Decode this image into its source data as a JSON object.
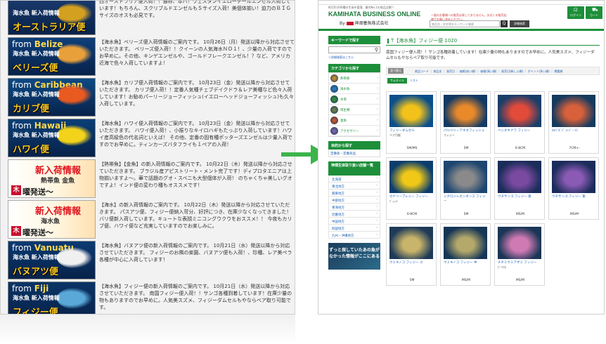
{
  "left_panel": {
    "rows": [
      {
        "kind": "region",
        "from": "",
        "tag": "海水魚 新入荷情報",
        "region": "オーストラリア便",
        "fish_color": "#d4a020",
        "bg": "#1b3b6e",
        "text": "西オーストラリア便入荷！！通称、本バ！ウェスタンイエローテールエンゼル入荷しています！もちろん、スクリブルドエンゼルもＳサイズ入荷！美個体揃い！迫力のＢＩＧサイズのオスも必見です。"
      },
      {
        "kind": "region",
        "from": "Belize",
        "tag": "海水魚 新入荷情報",
        "region": "ベリーズ便",
        "fish_color": "#e8a03a",
        "bg": "#0f3f7a",
        "text": "【海水魚】ベリーズ便入荷情報のご案内です。 10月26日（月）発送以降から対応させていただきます。 ベリーズ便入荷！！クイーンの人気海水ＮＯ１！、少量の入荷ですのでお早めに。その他、キンゲエンゼルや、ゴールドフレークエンゼル！？など、アメリカ近海で色々入荷していますよ！"
      },
      {
        "kind": "region",
        "from": "Caribbean",
        "tag": "海水魚 新入荷情報",
        "region": "カリブ便",
        "fish_color": "#e85a20",
        "bg": "#0d4a85",
        "text": "【海水魚】カリブ便入荷情報のご案内です。 10月23日（金）発送以降から対応させていただきます。 カリブ便入荷！！定番人気種チェブデイクドラ＆レア美種など色々入荷しています！お勧めパーリージョーフィッシュ(イエローヘッドジョーフィッシュ)も久々入荷しています。"
      },
      {
        "kind": "region",
        "from": "Hawaii",
        "tag": "海水魚 新入荷情報",
        "region": "ハワイ便",
        "fish_color": "#f2d21a",
        "bg": "#0b3f76",
        "text": "【海水魚】ハワイ便入荷情報のご案内です。 10月23日（金）発送以降から対応させていただきます。 ハワイ便入荷！、小振りなキイロハギもたっぷり入荷しています！ハワイ産高級色の代名詞といえば！ その他、定番の固有種ポッターズエンゼルは少量入荷ですのでお早めに。ティンカーズバタフライも１ペアの入荷！"
      },
      {
        "kind": "special",
        "sp1": "新入荷情報",
        "sp2": "熱帯魚 金魚",
        "sp3": "曜発送〜",
        "mark": "木",
        "text": "【熱帯魚】【金魚】の新入荷情報のご案内です。 10月22日（木）発送以降から対応させていただきます。 ブラジル産アピストリート・メント完了です！ディプロタエニアは上物揃いますよ〜。華で話題のグオ・スベニも大型個体が入荷！ のちゃくちゃ美しいグオですよ！インド便の変わり種もオススメです！"
      },
      {
        "kind": "special",
        "sp1": "新入荷情報",
        "sp2": "海水魚",
        "sp3": "曜発送〜",
        "mark": "木",
        "text": "【海水】の新入荷情報のご案内です。 10月22日（木）発送以降から対応させていただきます。 パスアツ便、フィジー便納入苛分、好評につき、在庫少なくなってきました！バリ便新入荷しています。キュートな表顔ミニコングウクウをおススメ！！ 今夜もカリブ便、ハワイ便など充実していますのでお楽しみに。"
      },
      {
        "kind": "region",
        "from": "Vanuatu",
        "tag": "海水魚 新入荷情報",
        "region": "バヌアツ便",
        "fish_color": "#f0f0f0",
        "bg": "#0a3a72",
        "text": "【海水魚】バヌアツ便の新入荷情報のご案内です。 10月21日（水）発送以降から対応させていただきます。 フィジーのお隣の楽園、バヌアツ便も入荷！、珍種、レア美ペラ各種が中心に入荷しています！"
      },
      {
        "kind": "region",
        "from": "Fiji",
        "tag": "海水魚 新入荷情報",
        "region": "フィジー便",
        "fish_color": "#5aa8d8",
        "bg": "#0a3466",
        "text": "【海水魚】フィジー便の新入荷情報のご案内です。 10月21日（水）発送以降から対応させていただきます。 南国フィジー便入荷！！サンゴ各種到着しています！在庫少量の物もありますのでお早めに。人気美スズメ、フィジーダムセルもやならべア取り可能です。"
      }
    ]
  },
  "arrow_color": "#3cb44b",
  "right_panel": {
    "topstrip": "約150,000種の生体を管理、業内No.1の商品点数!!",
    "logo": "KAMIHATA BUSINESS ONLINE",
    "company": "神畑養魚株式会社",
    "by": "By",
    "notice": "一般のお客様への販売は致しておりません。お近くの販売店様でお買い求めください。",
    "search_placeholder": "商品名・学名等をキーワード検索",
    "search_button": "Q",
    "advanced_search": "詳細検索",
    "login_label": "ログイン",
    "cart_label": "カート",
    "sidebar": {
      "keyword_header": "キーワードで探す",
      "keyword_link": "＞詳細検索はこちら",
      "category_header": "カテゴリから探す",
      "categories": [
        {
          "label": "熱帯魚",
          "color": "#e39b2c"
        },
        {
          "label": "海水魚",
          "color": "#2f84c8"
        },
        {
          "label": "水草",
          "color": "#3a9a3a"
        },
        {
          "label": "両生類",
          "color": "#7a8a4a"
        },
        {
          "label": "金魚",
          "color": "#e05a2a"
        },
        {
          "label": "アクセサリー",
          "color": "#8a6ab4"
        }
      ],
      "purpose_header": "目的から探す",
      "purpose_link": "定番魚・定番商品",
      "stores_header": "神畑生体取り扱い店舗一覧",
      "stores": [
        "北海道",
        "東北地方",
        "関東地方",
        "中部地方",
        "東海地方",
        "近畿地方",
        "中国地方",
        "四国地方",
        "九州・沖縄地方"
      ],
      "ad_text": "ずっと探していたあの魚が なかった情報がここにある"
    },
    "main": {
      "title": "T【海水魚】フィジー便 1020",
      "intro": "南国フィジー便入荷！！サンゴ各種到着しています！在庫少量の物もありますのでお早めに。人気美スズメ、フィジーダムセルもやならべア取り可能です。",
      "sort_label": "並べ替え",
      "sort_options": "商品コード ｜ 商品名 ｜ 発売日 ｜ 価格(安い順) ｜ 価格(高い順) ｜ 発売日(新しい順) ｜ ポイント(多い順) ｜ 掲載順",
      "view_thumbs": "サムネイル",
      "view_list": "リスト",
      "products": [
        {
          "name": "フィジーダムセル",
          "sub": "ペア可能",
          "size": "SM/MS",
          "c1": "#0b4f8a",
          "c2": "#f2c21a"
        },
        {
          "name": "パルべリーアネオフィッシュ",
          "sub": "フィジー",
          "size": "SM",
          "c1": "#123a64",
          "c2": "#e8892a"
        },
        {
          "name": "ベニオキナワ フィジー",
          "sub": "",
          "size": "6-8CM",
          "c1": "#1a3e6a",
          "c2": "#e24a3a"
        },
        {
          "name": "ﾙﾙﾊﾞﾎﾞｼﾞ ﾌｨｼﾞｰ ﾒｽ",
          "sub": "",
          "size": "7CM+-",
          "c1": "#143a5e",
          "c2": "#d8603a"
        },
        {
          "name": "カナリーブレニー フィジー",
          "sub": "ﾃﾞｭｪｯﾄ",
          "size": "6-8CM",
          "c1": "#0c3e6c",
          "c2": "#f0c818"
        },
        {
          "name": "シグロジャカンダンス フィジー",
          "sub": "",
          "size": "SM",
          "c1": "#1e4670",
          "c2": "#8a8a8a"
        },
        {
          "name": "ウタサンゴ フィジー 紫",
          "sub": "",
          "size": "MS/M",
          "c1": "#1a2c5a",
          "c2": "#7a4aa0"
        },
        {
          "name": "ウタサンゴ フィジー 紫",
          "sub": "",
          "size": "MS/M",
          "c1": "#1a2c5a",
          "c2": "#8a5ab4"
        },
        {
          "name": "ウミキノコ フィジー 小",
          "sub": "",
          "size": "SM",
          "c1": "#1e3a58",
          "c2": "#c8b46a"
        },
        {
          "name": "ウミキノコ フィジー 中",
          "sub": "",
          "size": "MS/M",
          "c1": "#163656",
          "c2": "#b4a86a"
        },
        {
          "name": "チヂミウミアザミ フィジー",
          "sub": "ﾋﾟﾝｸｸﾛ",
          "size": "MS/M",
          "c1": "#1a3656",
          "c2": "#d07ab4"
        }
      ]
    }
  }
}
